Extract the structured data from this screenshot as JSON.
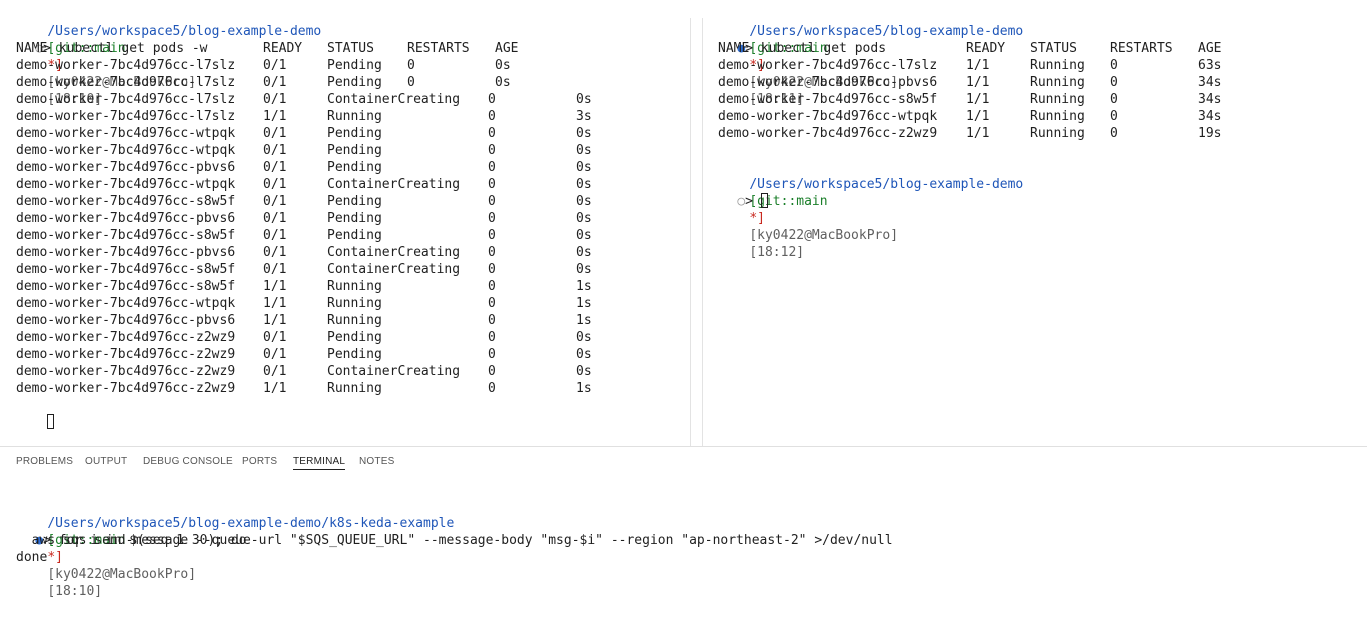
{
  "left": {
    "prompt": {
      "path": "/Users/workspace5/blog-example-demo",
      "git": "[git::main",
      "star": "*]",
      "user": "[ky0422@MacBookPro]",
      "time": "[18:10]"
    },
    "command": "> kubectl get pods -w",
    "headers": [
      "NAME",
      "READY",
      "STATUS",
      "RESTARTS",
      "AGE"
    ],
    "rows": [
      [
        "demo-worker-7bc4d976cc-l7slz",
        "0/1",
        "Pending",
        "0",
        "0s"
      ],
      [
        "demo-worker-7bc4d976cc-l7slz",
        "0/1",
        "Pending",
        "0",
        "0s"
      ],
      [
        "demo-worker-7bc4d976cc-l7slz",
        "0/1",
        "ContainerCreating",
        "0",
        "0s"
      ],
      [
        "demo-worker-7bc4d976cc-l7slz",
        "1/1",
        "Running",
        "0",
        "3s"
      ],
      [
        "demo-worker-7bc4d976cc-wtpqk",
        "0/1",
        "Pending",
        "0",
        "0s"
      ],
      [
        "demo-worker-7bc4d976cc-wtpqk",
        "0/1",
        "Pending",
        "0",
        "0s"
      ],
      [
        "demo-worker-7bc4d976cc-pbvs6",
        "0/1",
        "Pending",
        "0",
        "0s"
      ],
      [
        "demo-worker-7bc4d976cc-wtpqk",
        "0/1",
        "ContainerCreating",
        "0",
        "0s"
      ],
      [
        "demo-worker-7bc4d976cc-s8w5f",
        "0/1",
        "Pending",
        "0",
        "0s"
      ],
      [
        "demo-worker-7bc4d976cc-pbvs6",
        "0/1",
        "Pending",
        "0",
        "0s"
      ],
      [
        "demo-worker-7bc4d976cc-s8w5f",
        "0/1",
        "Pending",
        "0",
        "0s"
      ],
      [
        "demo-worker-7bc4d976cc-pbvs6",
        "0/1",
        "ContainerCreating",
        "0",
        "0s"
      ],
      [
        "demo-worker-7bc4d976cc-s8w5f",
        "0/1",
        "ContainerCreating",
        "0",
        "0s"
      ],
      [
        "demo-worker-7bc4d976cc-s8w5f",
        "1/1",
        "Running",
        "0",
        "1s"
      ],
      [
        "demo-worker-7bc4d976cc-wtpqk",
        "1/1",
        "Running",
        "0",
        "1s"
      ],
      [
        "demo-worker-7bc4d976cc-pbvs6",
        "1/1",
        "Running",
        "0",
        "1s"
      ],
      [
        "demo-worker-7bc4d976cc-z2wz9",
        "0/1",
        "Pending",
        "0",
        "0s"
      ],
      [
        "demo-worker-7bc4d976cc-z2wz9",
        "0/1",
        "Pending",
        "0",
        "0s"
      ],
      [
        "demo-worker-7bc4d976cc-z2wz9",
        "0/1",
        "ContainerCreating",
        "0",
        "0s"
      ],
      [
        "demo-worker-7bc4d976cc-z2wz9",
        "1/1",
        "Running",
        "0",
        "1s"
      ]
    ]
  },
  "right": {
    "prompt": {
      "path": "/Users/workspace5/blog-example-demo",
      "git": "[git::main",
      "star": "*]",
      "user": "[ky0422@MacBookPro]",
      "time": "[18:11]"
    },
    "command": "> kubectl get pods",
    "headers": [
      "NAME",
      "READY",
      "STATUS",
      "RESTARTS",
      "AGE"
    ],
    "rows": [
      [
        "demo-worker-7bc4d976cc-l7slz",
        "1/1",
        "Running",
        "0",
        "63s"
      ],
      [
        "demo-worker-7bc4d976cc-pbvs6",
        "1/1",
        "Running",
        "0",
        "34s"
      ],
      [
        "demo-worker-7bc4d976cc-s8w5f",
        "1/1",
        "Running",
        "0",
        "34s"
      ],
      [
        "demo-worker-7bc4d976cc-wtpqk",
        "1/1",
        "Running",
        "0",
        "34s"
      ],
      [
        "demo-worker-7bc4d976cc-z2wz9",
        "1/1",
        "Running",
        "0",
        "19s"
      ]
    ],
    "prompt2": {
      "path": "/Users/workspace5/blog-example-demo",
      "git": "[git::main",
      "star": "*]",
      "user": "[ky0422@MacBookPro]",
      "time": "[18:12]"
    },
    "prompt_symbol": ">"
  },
  "tabs": [
    "PROBLEMS",
    "OUTPUT",
    "DEBUG CONSOLE",
    "PORTS",
    "TERMINAL",
    "NOTES"
  ],
  "active_tab": "TERMINAL",
  "bottom": {
    "prompt": {
      "path": "/Users/workspace5/blog-example-demo/k8s-keda-example",
      "git": "[git::main",
      "star": "*]",
      "user": "[ky0422@MacBookPro]",
      "time": "[18:10]"
    },
    "lines": [
      "> for i in $(seq 1 30); do",
      "  aws sqs send-message --queue-url \"$SQS_QUEUE_URL\" --message-body \"msg-$i\" --region \"ap-northeast-2\" >/dev/null",
      "done"
    ]
  },
  "colors": {
    "path": "#1f56b8",
    "git": "#1b7f2a",
    "star": "#c8281e",
    "dot": "#2f6fd6"
  }
}
